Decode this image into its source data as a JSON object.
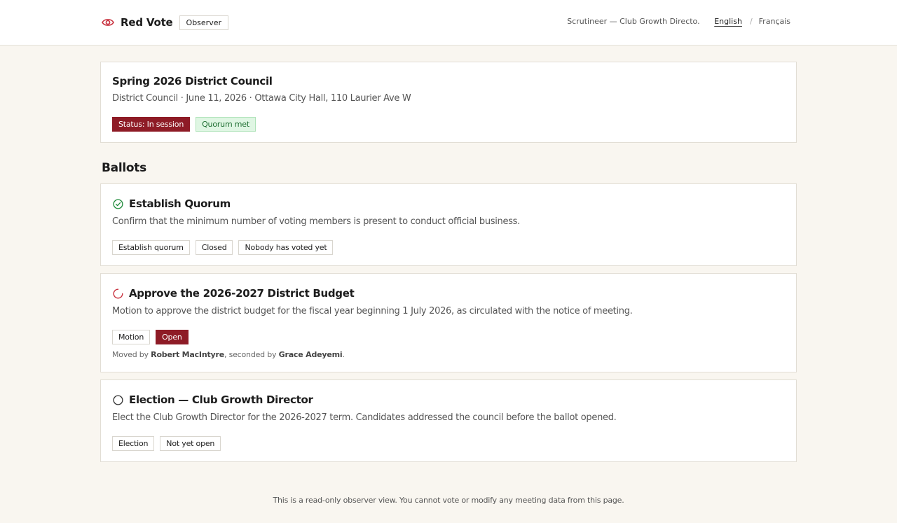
{
  "header": {
    "app_name": "Red Vote",
    "role_badge": "Observer",
    "user_label": "Scrutineer — Club Growth Directo...",
    "languages": [
      "English",
      "Français"
    ],
    "language_separator": "/",
    "active_language": "English",
    "brand_icon": "eye-icon",
    "accent_color": "#8e1b26"
  },
  "meeting": {
    "title": "Spring 2026 District Council",
    "meta": "District Council · June 11, 2026 · Ottawa City Hall, 110 Laurier Ave W",
    "status_badge": "Status: In session",
    "quorum_badge": "Quorum met"
  },
  "ballots_section": {
    "title": "Ballots",
    "items": [
      {
        "title": "Establish Quorum",
        "status_icon": "check-circle-icon",
        "description": "Confirm that the minimum number of voting members is present to conduct official business.",
        "badges": [
          "Establish quorum",
          "Closed",
          "Nobody has voted yet"
        ]
      },
      {
        "title": "Approve the 2026-2027 District Budget",
        "status_icon": "spinner-icon",
        "description": "Motion to approve the district budget for the fiscal year beginning 1 July 2026, as circulated with the notice of meeting.",
        "badges": [
          "Motion",
          "Open"
        ],
        "mover_prefix": "Moved by ",
        "mover": "Robert MacIntyre",
        "seconder_prefix": ", seconded by ",
        "seconder": "Grace Adeyemi",
        "mover_suffix": "."
      },
      {
        "title": "Election — Club Growth Director",
        "status_icon": "empty-circle-icon",
        "description": "Elect the Club Growth Director for the 2026-2027 term. Candidates addressed the council before the ballot opened.",
        "badges": [
          "Election",
          "Not yet open"
        ]
      }
    ]
  },
  "footer": {
    "note": "This is a read-only observer view. You cannot vote or modify any meeting data from this page."
  }
}
